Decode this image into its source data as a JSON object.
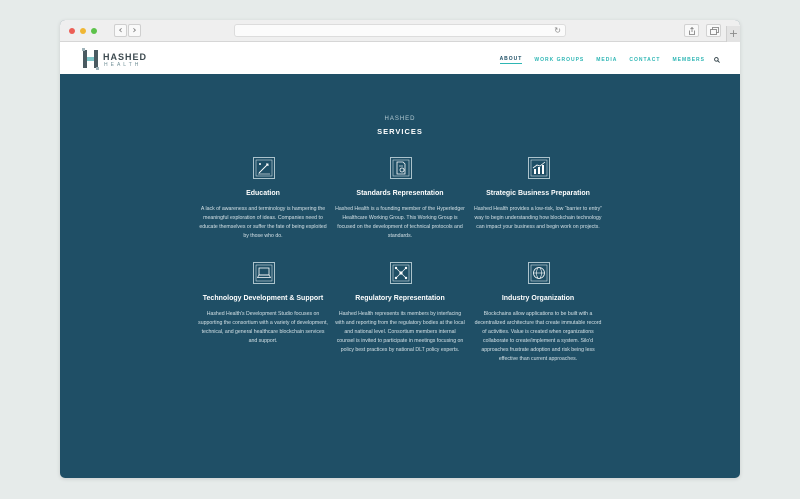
{
  "browser": {
    "back_glyph": "‹",
    "forward_glyph": "›",
    "reload_glyph": "↻",
    "new_tab_glyph": "+"
  },
  "site": {
    "logo": {
      "name": "HASHED",
      "sub": "HEALTH"
    },
    "menu": [
      "ABOUT",
      "WORK GROUPS",
      "MEDIA",
      "CONTACT",
      "MEMBERS"
    ],
    "active_menu": "ABOUT"
  },
  "section": {
    "eyebrow": "HASHED",
    "title": "SERVICES"
  },
  "services": [
    {
      "icon": "education-icon",
      "title": "Education",
      "description": "A lack of awareness and terminology is hampering the meaningful exploration of ideas. Companies need to educate themselves or suffer the fate of being exploited by those who do."
    },
    {
      "icon": "standards-document-icon",
      "title": "Standards Representation",
      "description": "Hashed Health is a founding member of the Hyperledger Healthcare Working Group. This Working Group is focused on the development of technical protocols and standards."
    },
    {
      "icon": "business-chart-icon",
      "title": "Strategic Business Preparation",
      "description": "Hashed Health provides a low-risk, low “barrier to entry” way to begin understanding how blockchain technology can impact your business and begin work on projects."
    },
    {
      "icon": "laptop-icon",
      "title": "Technology Development & Support",
      "description": "Hashed Health's Development Studio focuses on supporting the consortium with a variety of development, technical, and general healthcare blockchain services and support."
    },
    {
      "icon": "regulatory-network-icon",
      "title": "Regulatory Representation",
      "description": "Hashed Health represents its members by interfacing with and reporting from the regulatory bodies at the local and national level. Consortium members internal counsel is invited to participate in meetings focusing on policy best practices by national DLT policy experts."
    },
    {
      "icon": "globe-icon",
      "title": "Industry Organization",
      "description": "Blockchains allow applications to be built with a decentralized architecture that create immutable record of activities. Value is created when organizations collaborate to create/implement a system. Silo'd approaches frustrate adoption and risk being less effective than current approaches."
    }
  ],
  "colors": {
    "page_background": "#1f4f66",
    "accent": "#2eb6b4",
    "header_background": "#ffffff"
  }
}
